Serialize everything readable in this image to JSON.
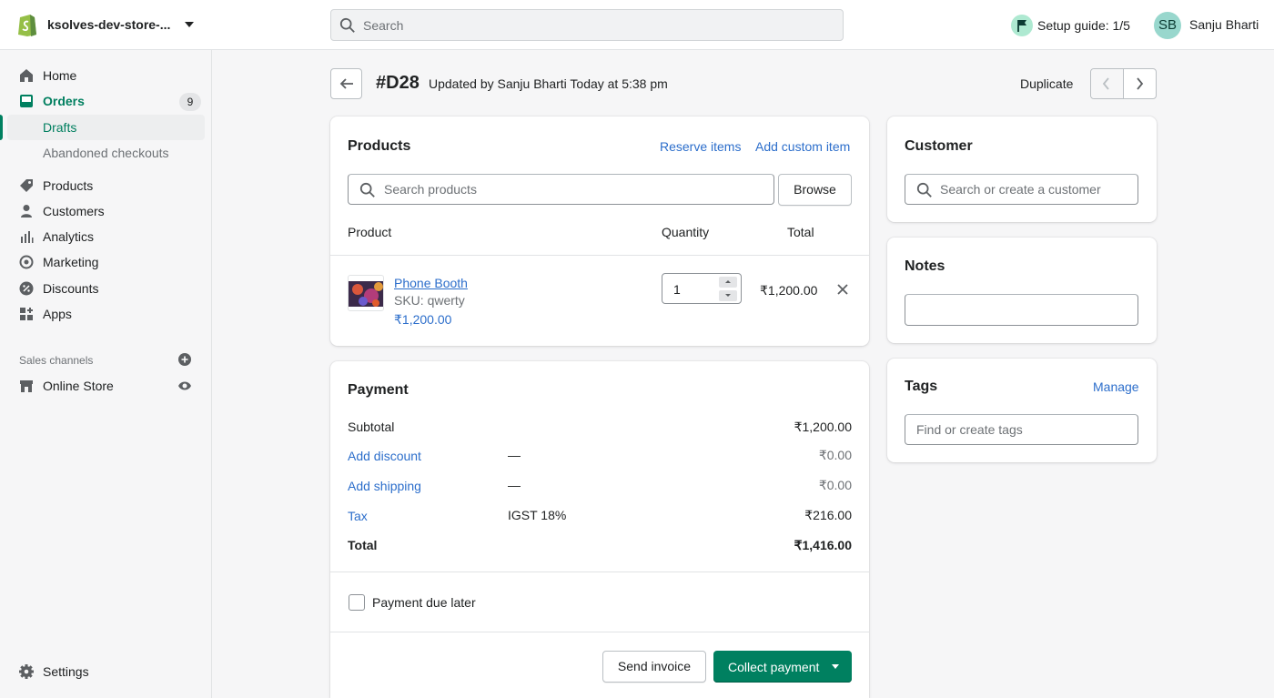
{
  "topbar": {
    "store_name": "ksolves-dev-store-...",
    "search_placeholder": "Search",
    "setup_guide": "Setup guide: 1/5",
    "avatar_initials": "SB",
    "user_name": "Sanju Bharti"
  },
  "sidebar": {
    "home": "Home",
    "orders": "Orders",
    "orders_badge": "9",
    "drafts": "Drafts",
    "abandoned": "Abandoned checkouts",
    "products": "Products",
    "customers": "Customers",
    "analytics": "Analytics",
    "marketing": "Marketing",
    "discounts": "Discounts",
    "apps": "Apps",
    "sales_channels": "Sales channels",
    "online_store": "Online Store",
    "settings": "Settings"
  },
  "header": {
    "title": "#D28",
    "subtitle": "Updated by Sanju Bharti Today at 5:38 pm",
    "duplicate": "Duplicate"
  },
  "products_card": {
    "title": "Products",
    "reserve_items": "Reserve items",
    "add_custom_item": "Add custom item",
    "search_placeholder": "Search products",
    "browse": "Browse",
    "col_product": "Product",
    "col_quantity": "Quantity",
    "col_total": "Total",
    "item": {
      "name": "Phone Booth",
      "sku": "SKU: qwerty",
      "price": "₹1,200.00",
      "quantity": "1",
      "total": "₹1,200.00"
    }
  },
  "payment_card": {
    "title": "Payment",
    "subtotal_label": "Subtotal",
    "subtotal_value": "₹1,200.00",
    "discount_label": "Add discount",
    "discount_dash": "—",
    "discount_value": "₹0.00",
    "shipping_label": "Add shipping",
    "shipping_dash": "—",
    "shipping_value": "₹0.00",
    "tax_label": "Tax",
    "tax_desc": "IGST 18%",
    "tax_value": "₹216.00",
    "total_label": "Total",
    "total_value": "₹1,416.00",
    "payment_due_later": "Payment due later",
    "send_invoice": "Send invoice",
    "collect_payment": "Collect payment"
  },
  "customer_card": {
    "title": "Customer",
    "search_placeholder": "Search or create a customer"
  },
  "notes_card": {
    "title": "Notes"
  },
  "tags_card": {
    "title": "Tags",
    "manage": "Manage",
    "placeholder": "Find or create tags"
  },
  "colors": {
    "primary": "#008060",
    "link": "#2c6ecb",
    "active_nav": "#007f5f"
  }
}
